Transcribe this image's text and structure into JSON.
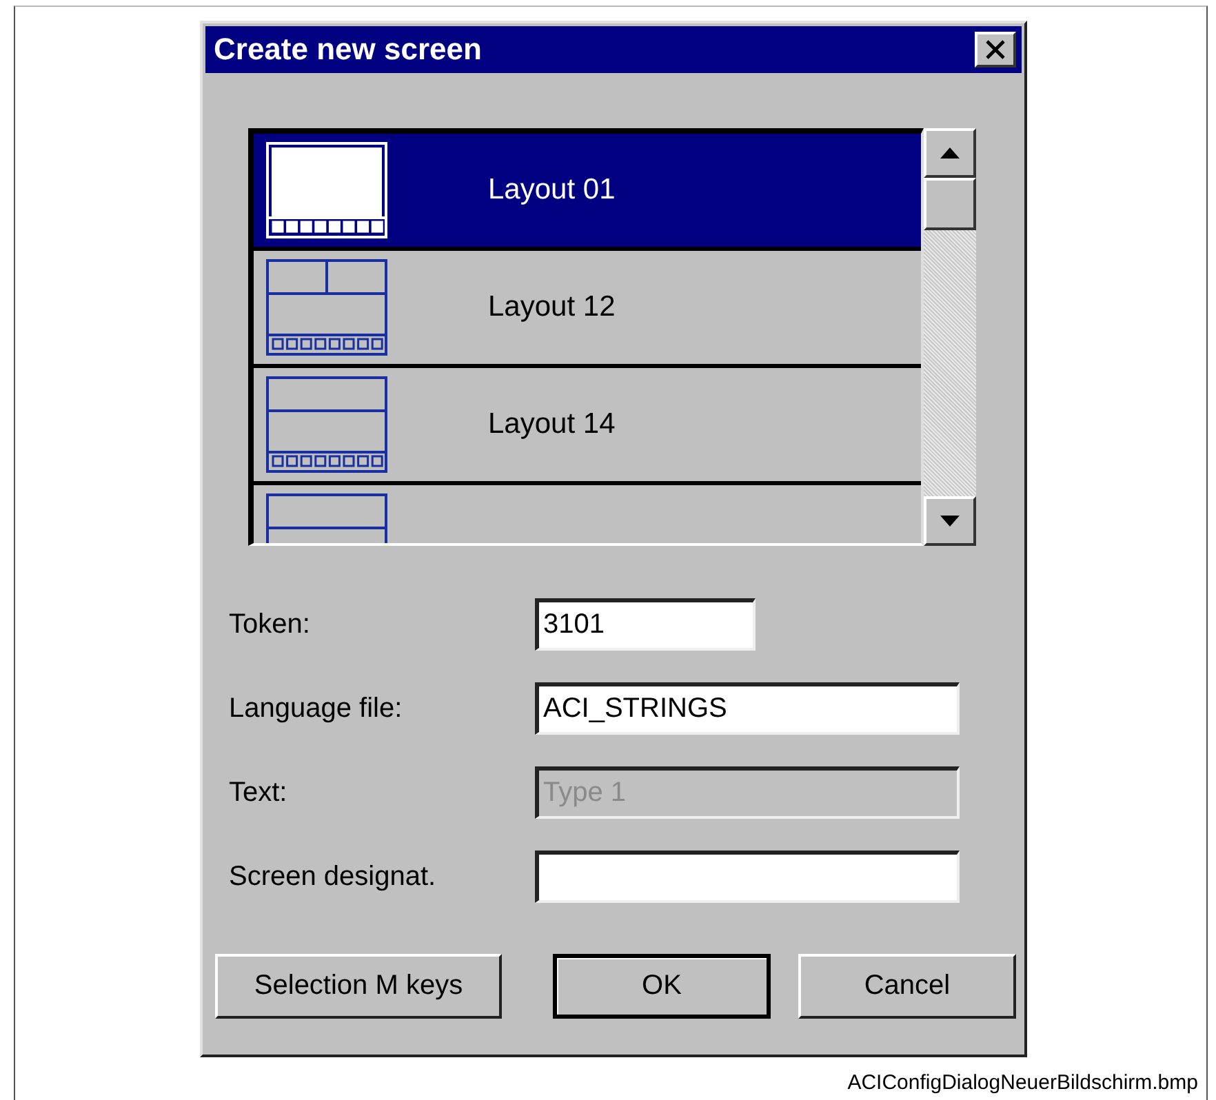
{
  "window": {
    "title": "Create new screen"
  },
  "layouts": [
    {
      "label": "Layout 01",
      "kind": "full",
      "selected": true
    },
    {
      "label": "Layout 12",
      "kind": "split-top",
      "selected": false
    },
    {
      "label": "Layout 14",
      "kind": "two-rows",
      "selected": false
    },
    {
      "kind": "two-rows",
      "selected": false
    }
  ],
  "fields": [
    {
      "label": "Token:",
      "value": "3101",
      "kind": "short",
      "disabled": false
    },
    {
      "label": "Language file:",
      "value": "ACI_STRINGS",
      "kind": "long",
      "disabled": false
    },
    {
      "label": "Text:",
      "value": "Type 1",
      "kind": "long",
      "disabled": true
    },
    {
      "label": "Screen designat.",
      "kind": "long",
      "disabled": false
    }
  ],
  "buttons": [
    {
      "label": "Selection M keys",
      "default": false
    },
    {
      "label": "OK",
      "default": true
    },
    {
      "label": "Cancel",
      "default": false
    }
  ],
  "caption": "ACIConfigDialogNeuerBildschirm.bmp"
}
